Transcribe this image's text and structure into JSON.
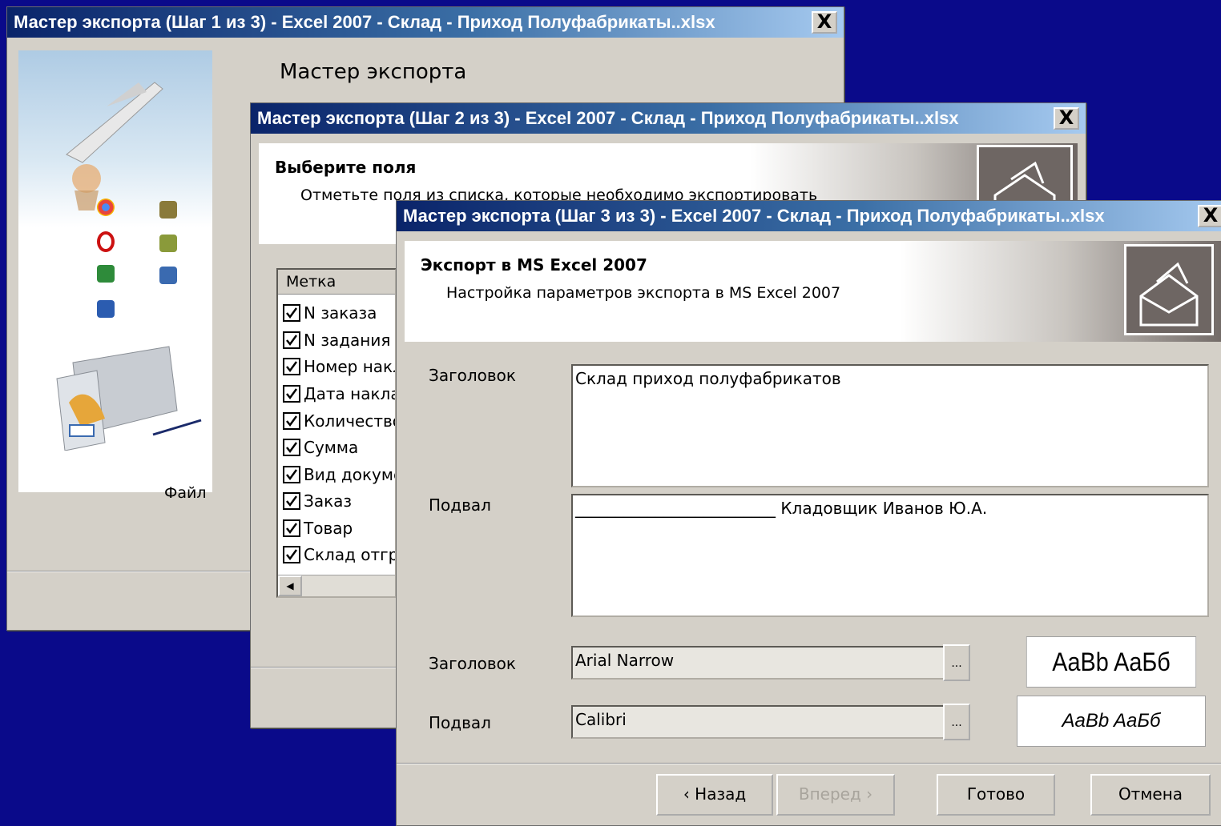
{
  "window1": {
    "title": "Мастер экспорта (Шаг 1 из 3) - Excel 2007 - Склад - Приход  Полуфабрикаты..xlsx",
    "close": "X",
    "heading": "Мастер экспорта",
    "partial_text": "Файл"
  },
  "window2": {
    "title": "Мастер экспорта (Шаг 2 из 3) - Excel 2007 - Склад - Приход  Полуфабрикаты..xlsx",
    "close": "X",
    "header_title": "Выберите поля",
    "header_subtitle": "Отметьте поля из списка, которые необходимо экспортировать",
    "list_header": "Метка",
    "fields": [
      {
        "label": "N заказа",
        "checked": true
      },
      {
        "label": "N задания",
        "checked": true
      },
      {
        "label": "Номер накладной",
        "checked": true
      },
      {
        "label": "Дата накладной",
        "checked": true
      },
      {
        "label": "Количество",
        "checked": true
      },
      {
        "label": "Сумма",
        "checked": true
      },
      {
        "label": "Вид документа",
        "checked": true
      },
      {
        "label": "Заказ",
        "checked": true
      },
      {
        "label": "Товар",
        "checked": true
      },
      {
        "label": "Склад отгрузки",
        "checked": true
      }
    ],
    "scroll_left": "◀"
  },
  "window3": {
    "title": "Мастер экспорта (Шаг 3 из 3) - Excel 2007 - Склад - Приход  Полуфабрикаты..xlsx",
    "close": "X",
    "header_title": "Экспорт в MS Excel 2007",
    "header_subtitle": "Настройка параметров экспорта в MS Excel 2007",
    "header_label": "Заголовок",
    "header_text": "Склад приход полуфабрикатов",
    "footer_label": "Подвал",
    "footer_text": "_________________________ Кладовщик Иванов Ю.А.",
    "header_font_label": "Заголовок",
    "header_font": "Arial Narrow",
    "footer_font_label": "Подвал",
    "footer_font": "Calibri",
    "browse": "...",
    "preview_header": "AaBb AaБб",
    "preview_footer": "AaBb AaБб",
    "buttons": {
      "back": "‹ Назад",
      "next": "Вперед ›",
      "finish": "Готово",
      "cancel": "Отмена"
    }
  }
}
